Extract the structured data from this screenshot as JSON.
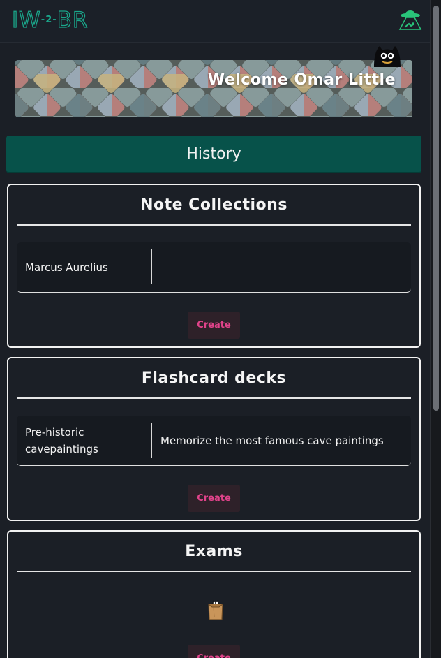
{
  "header": {
    "logo_left": "IW",
    "logo_mid": "-2-",
    "logo_right": "BR",
    "ufo_icon": "ufo-abduction-icon"
  },
  "banner": {
    "welcome_text": "Welcome Omar Little",
    "mascot_icon": "peeking-cat-icon"
  },
  "history": {
    "label": "History"
  },
  "note_collections": {
    "title": "Note Collections",
    "items": [
      {
        "name": "Marcus Aurelius",
        "description": ""
      }
    ],
    "create_label": "Create"
  },
  "flashcard_decks": {
    "title": "Flashcard decks",
    "items": [
      {
        "name": "Pre-historic cavepaintings",
        "description": "Memorize the most famous cave paintings"
      }
    ],
    "create_label": "Create"
  },
  "exams": {
    "title": "Exams",
    "empty_icon": "paper-bag-cat-icon",
    "create_label": "Create"
  },
  "colors": {
    "background": "#1b1f26",
    "accent_teal": "#07524a",
    "logo_teal": "#1aa68a",
    "create_text": "#e0438a",
    "create_bg": "#2e2129",
    "card_border": "#f2f2f2"
  }
}
